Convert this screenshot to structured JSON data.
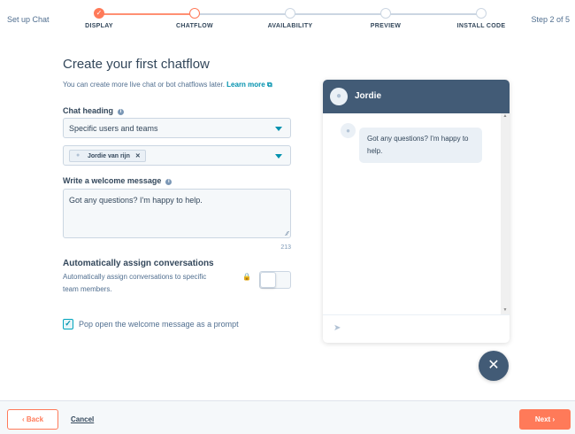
{
  "header": {
    "title": "Set up Chat",
    "step_counter": "Step 2 of 5",
    "steps": [
      {
        "label": "DISPLAY",
        "state": "complete"
      },
      {
        "label": "CHATFLOW",
        "state": "current"
      },
      {
        "label": "AVAILABILITY",
        "state": "pending"
      },
      {
        "label": "PREVIEW",
        "state": "pending"
      },
      {
        "label": "INSTALL CODE",
        "state": "pending"
      }
    ]
  },
  "form": {
    "title": "Create your first chatflow",
    "subtitle": "You can create more live chat or bot chatflows later.",
    "learn_more": "Learn more",
    "chat_heading_label": "Chat heading",
    "chat_heading_value": "Specific users and teams",
    "selected_user": "Jordie van rijn",
    "welcome_label": "Write a welcome message",
    "welcome_value": "Got any questions? I'm happy to help.",
    "char_count": "213",
    "auto_assign_title": "Automatically assign conversations",
    "auto_assign_desc": "Automatically assign conversations to specific team members.",
    "auto_assign_enabled": false,
    "popup_label": "Pop open the welcome message as a prompt",
    "popup_checked": true
  },
  "preview": {
    "name": "Jordie",
    "message": "Got any questions? I'm happy to help."
  },
  "footer": {
    "back": "Back",
    "cancel": "Cancel",
    "next": "Next"
  },
  "colors": {
    "accent": "#ff7a59",
    "header": "#425b76",
    "link": "#0091ae"
  }
}
